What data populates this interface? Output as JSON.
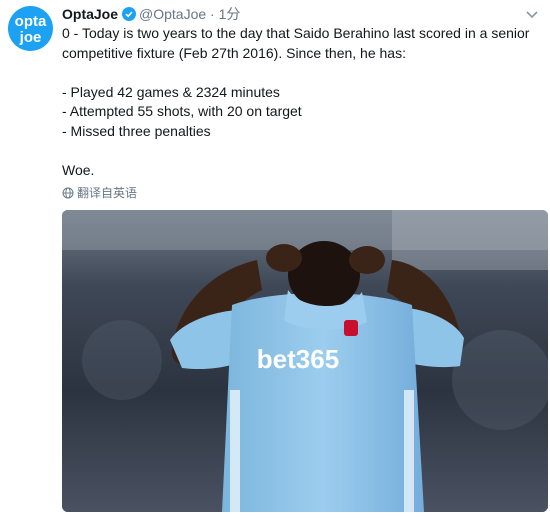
{
  "tweet": {
    "avatar": {
      "line1": "opta",
      "line2": "joe"
    },
    "display_name": "OptaJoe",
    "handle": "@OptaJoe",
    "separator": "·",
    "time": "1分",
    "lines": [
      "0 - Today is two years to the day that Saido Berahino last scored in a senior competitive fixture (Feb 27th 2016). Since then, he has:",
      "",
      "- Played 42 games & 2324 minutes",
      "- Attempted 55 shots, with 20 on target",
      "- Missed three penalties",
      "",
      "Woe."
    ],
    "translate_label": "翻译自英语",
    "photo": {
      "shirt_sponsor": "bet365"
    }
  },
  "colors": {
    "accent": "#1da1f2",
    "muted": "#657786",
    "shirt": "#8fc4e8"
  },
  "icons": {
    "verified": "verified-badge-icon",
    "caret": "chevron-down-icon",
    "translate": "globe-icon"
  }
}
